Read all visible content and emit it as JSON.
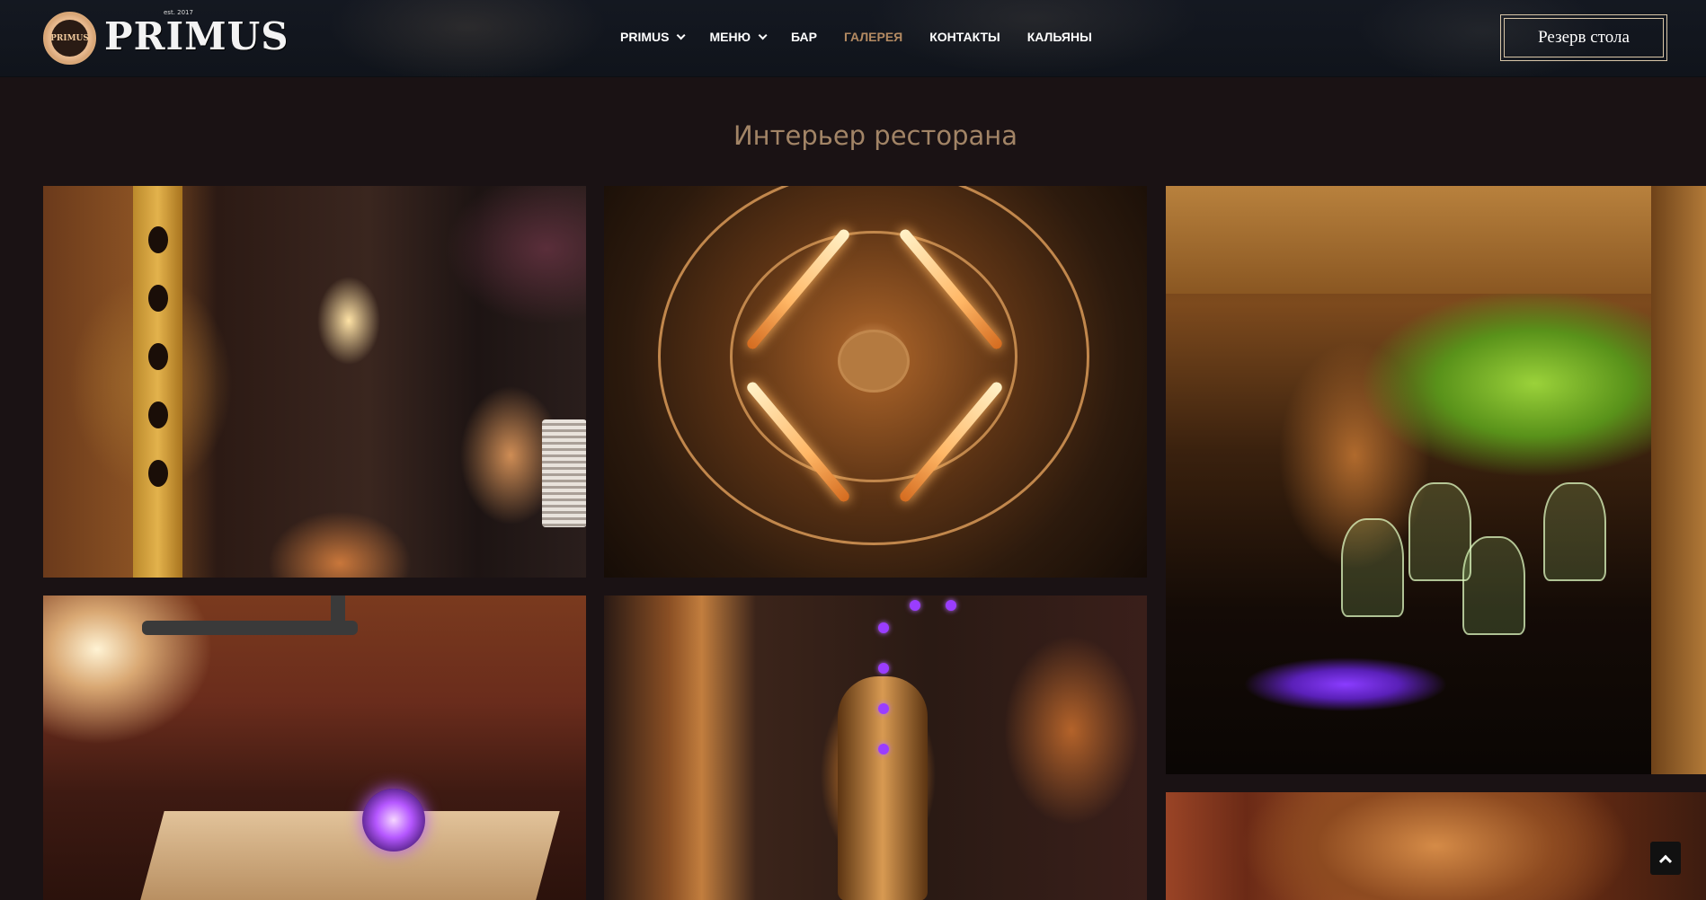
{
  "header": {
    "logo_badge_text": "PRIMUS",
    "logo_text": "PRIMUS",
    "logo_est": "est. 2017",
    "nav": [
      {
        "label": "PRIMUS",
        "has_dropdown": true,
        "active": false
      },
      {
        "label": "МЕНЮ",
        "has_dropdown": true,
        "active": false
      },
      {
        "label": "БАР",
        "has_dropdown": false,
        "active": false
      },
      {
        "label": "ГАЛЕРЕЯ",
        "has_dropdown": false,
        "active": true
      },
      {
        "label": "КОНТАКТЫ",
        "has_dropdown": false,
        "active": false
      },
      {
        "label": "КАЛЬЯНЫ",
        "has_dropdown": false,
        "active": false
      }
    ],
    "reserve_label": "Резерв стола"
  },
  "gallery": {
    "title": "Интерьер ресторана",
    "photos": [
      {
        "subject": "bar counter with copper burner and shaker"
      },
      {
        "subject": "steampunk wheel with edison bulbs"
      },
      {
        "subject": "green-lit wine glass rack"
      },
      {
        "subject": "table with typewriter and plasma orb"
      },
      {
        "subject": "diver figure with purple lights"
      },
      {
        "subject": "copper face sculpture"
      }
    ]
  },
  "colors": {
    "background": "#1a1214",
    "header_bg": "#131720",
    "title": "#a28466",
    "nav_active": "#b38a62",
    "nav": "#ffffff",
    "button_border": "#d8c6a8"
  },
  "icons": {
    "dropdown": "chevron-down-icon",
    "scroll_top": "arrow-up-icon"
  }
}
